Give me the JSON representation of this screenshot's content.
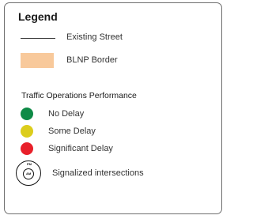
{
  "legend": {
    "title": "Legend",
    "items": [
      {
        "label": "Existing Street",
        "symbol": "line"
      },
      {
        "label": "BLNP Border",
        "symbol": "fill",
        "color": "#f8c99b"
      }
    ],
    "section_title": "Traffic Operations Performance",
    "performance": [
      {
        "label": "No Delay",
        "color": "#0e8a46"
      },
      {
        "label": "Some Delay",
        "color": "#dccd1c"
      },
      {
        "label": "Significant Delay",
        "color": "#e8202a"
      }
    ],
    "signal": {
      "label": "Signalized intersections",
      "top_text": "PM",
      "inner_text": "AM"
    }
  }
}
